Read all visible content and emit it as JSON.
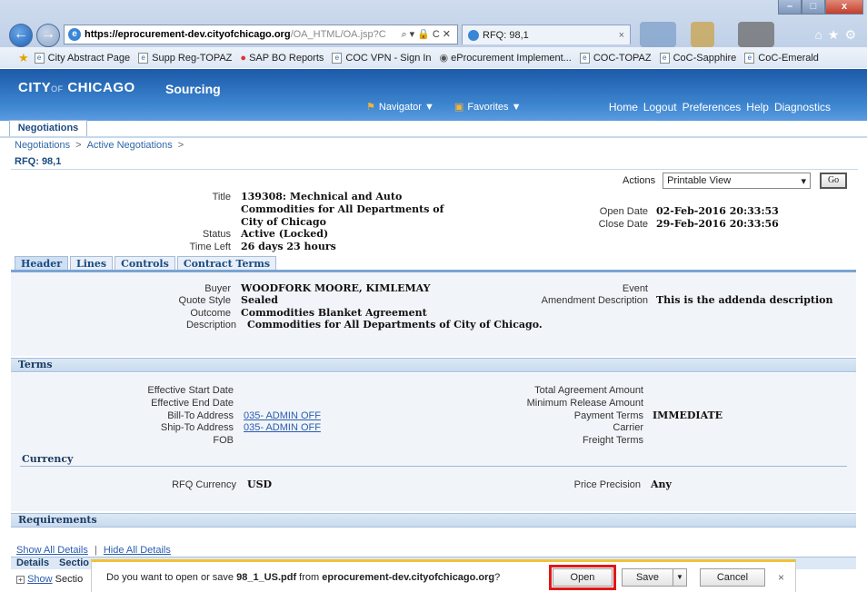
{
  "browser": {
    "url_host": "https://eprocurement-dev.cityofchicago.org",
    "url_path": "/OA_HTML/OA.jsp?C",
    "tab_title": "RFQ: 98,1",
    "tab_close": "×",
    "window_controls": {
      "minimize": "–",
      "maximize": "□",
      "close": "x"
    },
    "favorites": [
      "City Abstract Page",
      "Supp Reg-TOPAZ",
      "SAP BO Reports",
      "COC VPN - Sign In",
      "eProcurement Implement...",
      "COC-TOPAZ",
      "CoC-Sapphire",
      "CoC-Emerald"
    ]
  },
  "app": {
    "logo_city": "CITY",
    "logo_of": "OF",
    "logo_chicago": "CHICAGO",
    "module": "Sourcing",
    "navigator": "Navigator ▼",
    "favorites": "Favorites ▼",
    "global_links": [
      "Home",
      "Logout",
      "Preferences",
      "Help",
      "Diagnostics"
    ],
    "main_tab": "Negotiations"
  },
  "breadcrumbs": {
    "first": "Negotiations",
    "second": "Active Negotiations",
    "sep": ">"
  },
  "page_title": "RFQ: 98,1",
  "actions": {
    "label": "Actions",
    "selected": "Printable View",
    "go": "Go"
  },
  "summary": {
    "title_label": "Title",
    "title_line1": "139308: Mechnical and Auto",
    "title_line2": "Commodities for All Departments of",
    "title_line3": "City of Chicago",
    "status_label": "Status",
    "status": "Active (Locked)",
    "time_left_label": "Time Left",
    "time_left": "26 days 23 hours",
    "open_date_label": "Open Date",
    "open_date": "02-Feb-2016 20:33:53",
    "close_date_label": "Close Date",
    "close_date": "29-Feb-2016 20:33:56"
  },
  "subtabs": [
    "Header",
    "Lines",
    "Controls",
    "Contract Terms"
  ],
  "header": {
    "buyer_label": "Buyer",
    "buyer": "WOODFORK MOORE, KIMLEMAY",
    "quote_style_label": "Quote Style",
    "quote_style": "Sealed",
    "outcome_label": "Outcome",
    "outcome": "Commodities Blanket Agreement",
    "description_label": "Description",
    "description": "Commodities for All Departments of City of Chicago.",
    "event_label": "Event",
    "amendment_label": "Amendment Description",
    "amendment": "This is the addenda description"
  },
  "terms": {
    "section_title": "Terms",
    "effective_start_label": "Effective Start Date",
    "effective_end_label": "Effective End Date",
    "bill_to_label": "Bill-To Address",
    "bill_to": "035- ADMIN OFF",
    "ship_to_label": "Ship-To Address",
    "ship_to": "035- ADMIN OFF",
    "fob_label": "FOB",
    "total_amount_label": "Total Agreement Amount",
    "min_release_label": "Minimum Release Amount",
    "payment_terms_label": "Payment Terms",
    "payment_terms": "IMMEDIATE",
    "carrier_label": "Carrier",
    "freight_terms_label": "Freight Terms"
  },
  "currency": {
    "section_title": "Currency",
    "rfq_currency_label": "RFQ Currency",
    "rfq_currency": "USD",
    "price_precision_label": "Price Precision",
    "price_precision": "Any"
  },
  "requirements": {
    "section_title": "Requirements",
    "show_all": "Show All Details",
    "hide_all": "Hide All Details",
    "details_col": "Details",
    "section_col": "Sectio",
    "show": "Show",
    "row_section": "Sectio"
  },
  "download_bar": {
    "prefix": "Do you want to open or save ",
    "filename": "98_1_US.pdf",
    "middle": " from ",
    "host": "eprocurement-dev.cityofchicago.org",
    "suffix": "?",
    "open": "Open",
    "save": "Save",
    "drop": "▼",
    "cancel": "Cancel",
    "close": "×"
  }
}
